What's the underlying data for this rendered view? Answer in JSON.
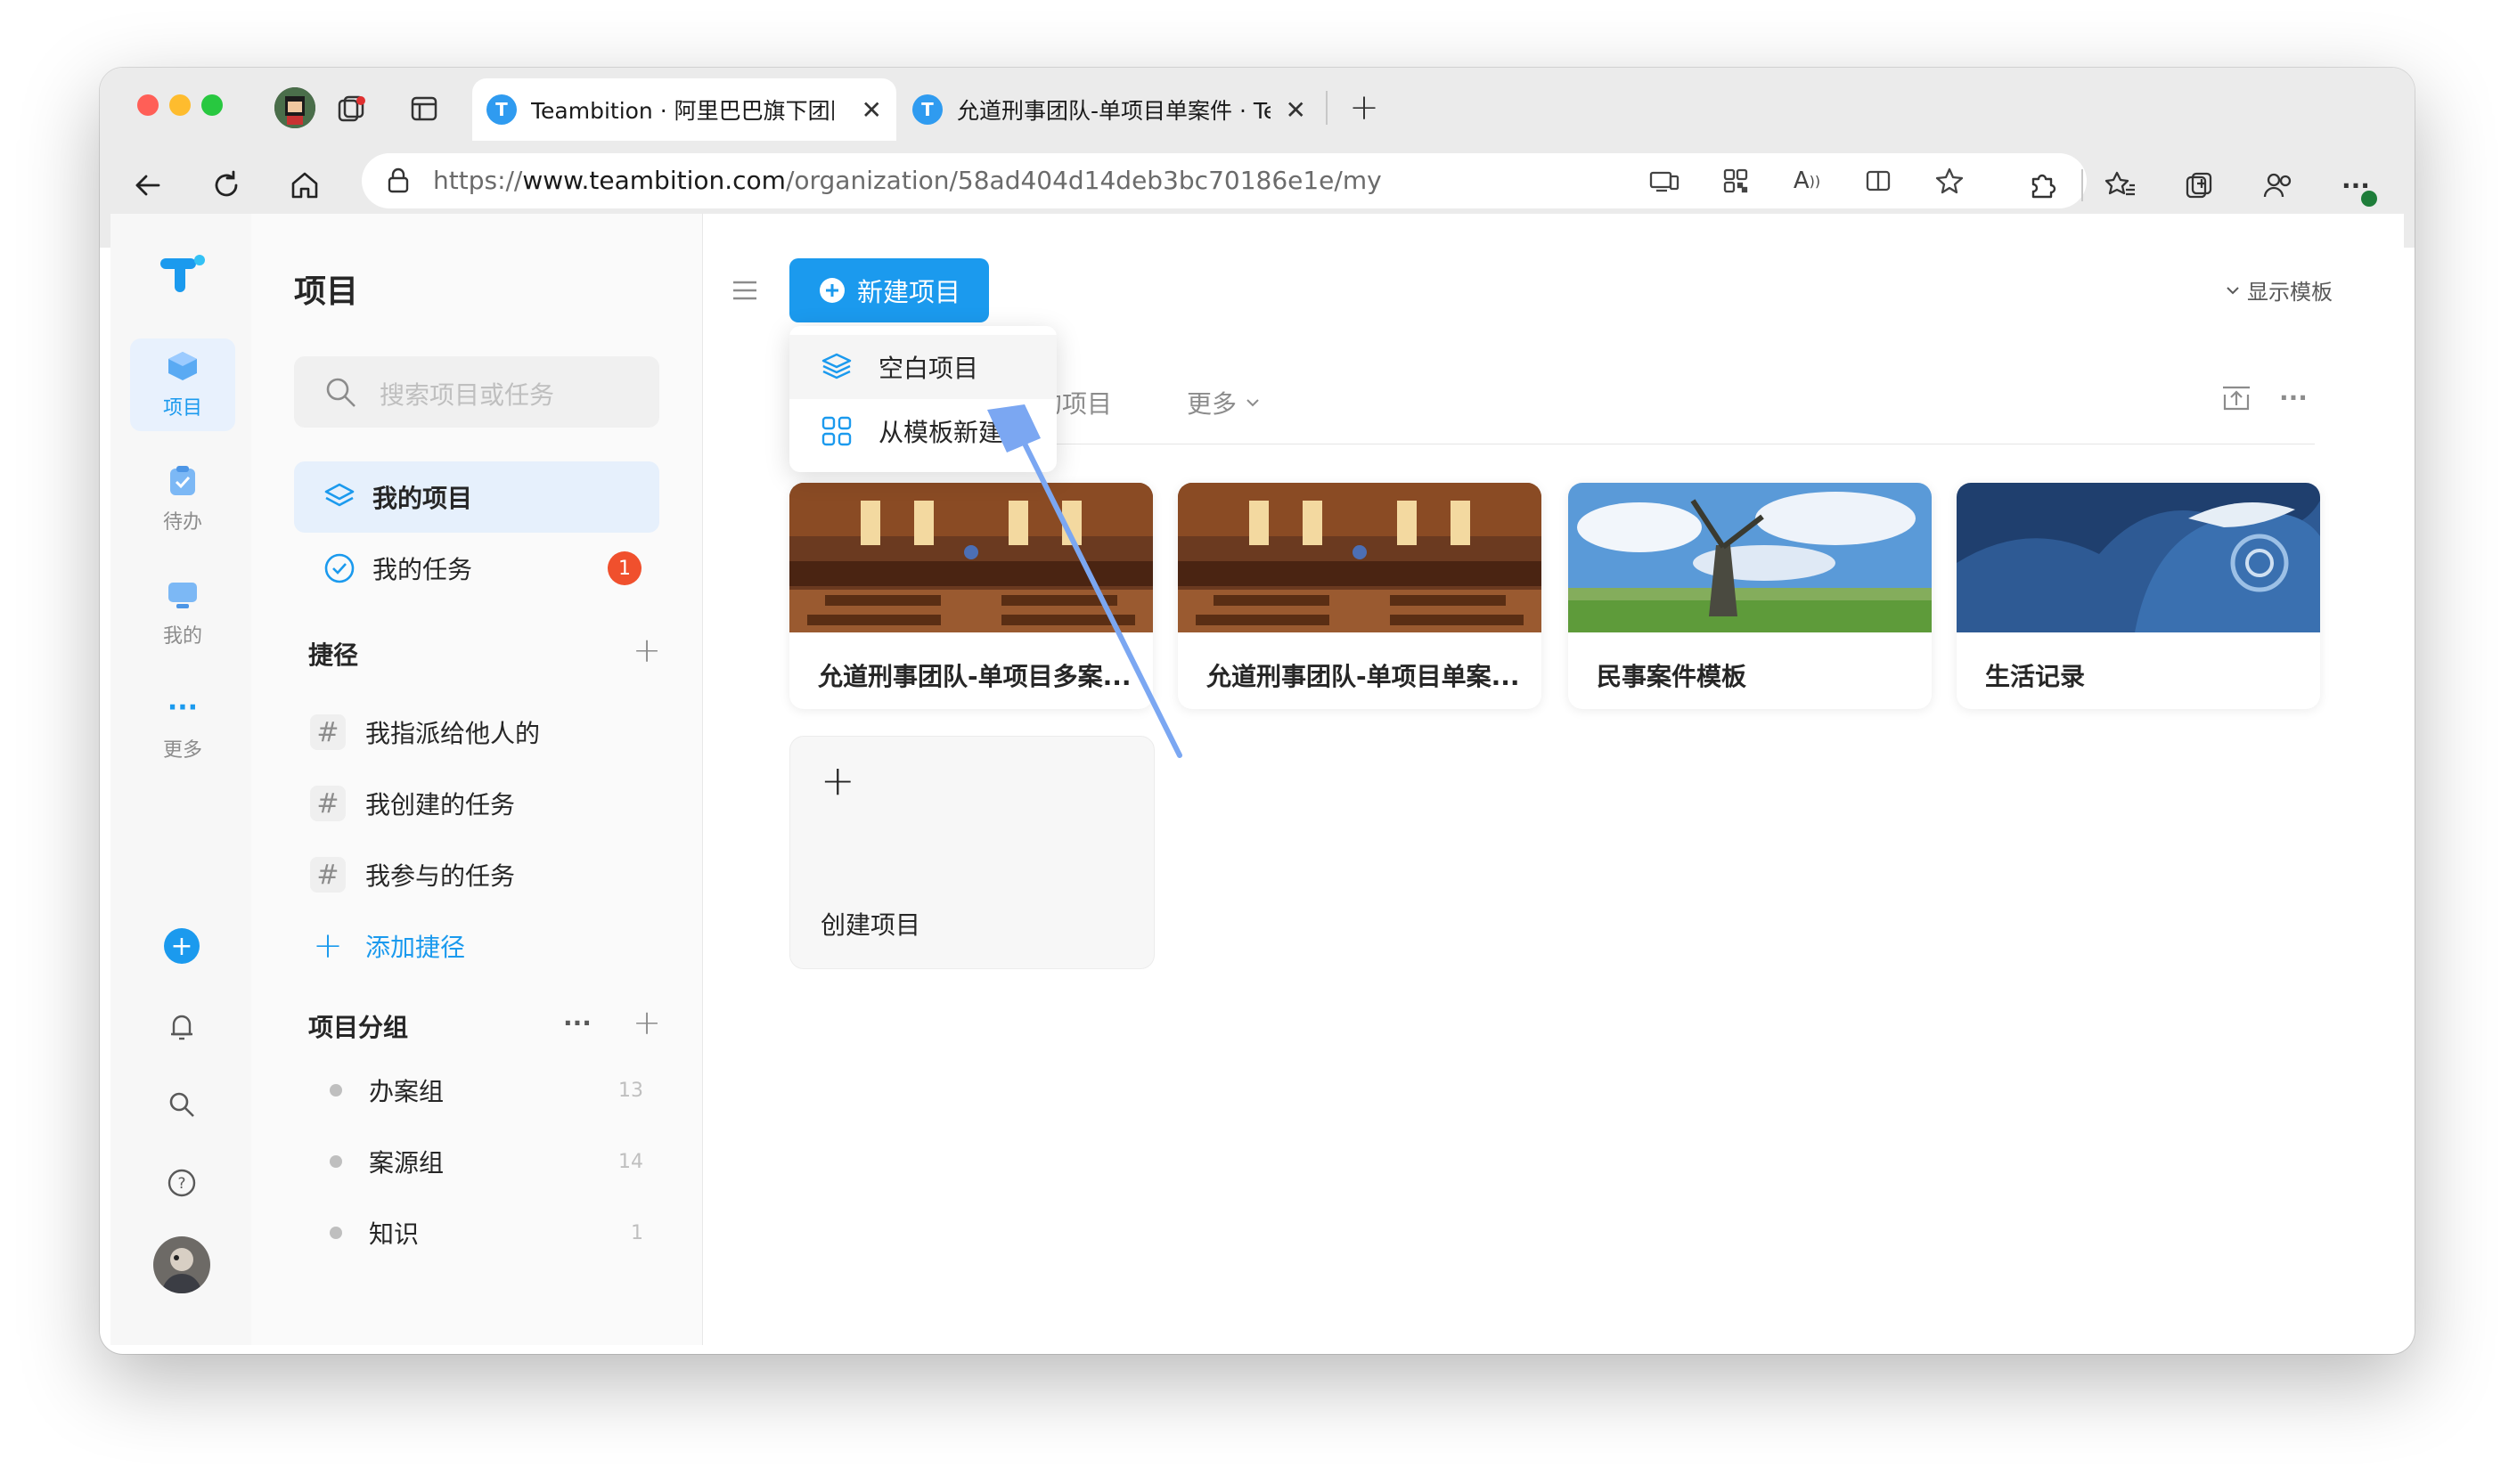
{
  "browser": {
    "tabs": [
      {
        "title": "Teambition · 阿里巴巴旗下团队",
        "favicon": "T"
      },
      {
        "title": "允道刑事团队-单项目单案件 · Te",
        "favicon": "T"
      }
    ],
    "url": {
      "prefix": "https://",
      "host": "www.teambition.com",
      "path": "/organization/58ad404d14deb3bc70186e1e/my"
    }
  },
  "rail": {
    "items": [
      {
        "label": "项目"
      },
      {
        "label": "待办"
      },
      {
        "label": "我的"
      },
      {
        "label": "更多"
      }
    ]
  },
  "sidebar": {
    "title": "项目",
    "search_placeholder": "搜索项目或任务",
    "nav": [
      {
        "label": "我的项目"
      },
      {
        "label": "我的任务",
        "badge": "1"
      }
    ],
    "shortcuts_title": "捷径",
    "shortcuts": [
      {
        "label": "我指派给他人的"
      },
      {
        "label": "我创建的任务"
      },
      {
        "label": "我参与的任务"
      }
    ],
    "add_shortcut": "添加捷径",
    "groups_title": "项目分组",
    "groups": [
      {
        "label": "办案组",
        "count": "13"
      },
      {
        "label": "案源组",
        "count": "14"
      },
      {
        "label": "知识",
        "count": "1"
      }
    ]
  },
  "main": {
    "new_project_label": "新建项目",
    "show_templates_label": "显示模板",
    "filter_partial": "的项目",
    "filter_more": "更多",
    "dropdown": [
      {
        "label": "空白项目"
      },
      {
        "label": "从模板新建"
      }
    ],
    "projects": [
      {
        "title": "允道刑事团队-单项目多案..."
      },
      {
        "title": "允道刑事团队-单项目单案..."
      },
      {
        "title": "民事案件模板"
      },
      {
        "title": "生活记录"
      }
    ],
    "create_label": "创建项目"
  },
  "colors": {
    "accent": "#1b9aee",
    "badge": "#f0502d",
    "arrow": "#7ba7f2"
  }
}
